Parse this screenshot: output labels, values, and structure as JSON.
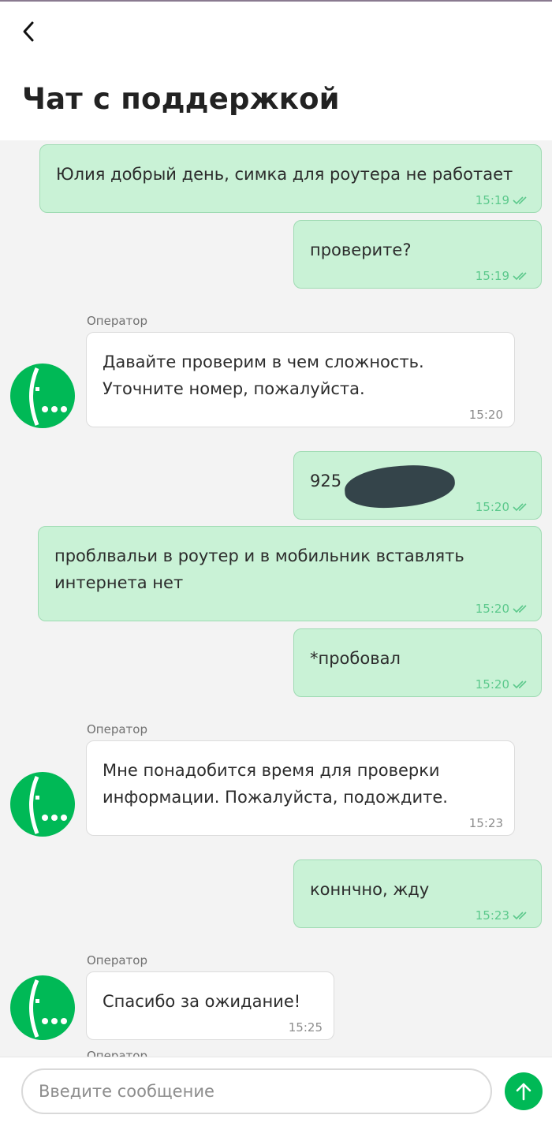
{
  "header": {
    "title": "Чат с поддержкой"
  },
  "messages": [
    {
      "sender": "user",
      "text": "Юлия добрый день, симка для роутера не работает",
      "time": "15:19"
    },
    {
      "sender": "user",
      "text": "проверите?",
      "time": "15:19"
    },
    {
      "sender": "operator",
      "label": "Оператор",
      "text": "Давайте проверим в чем сложность. Уточните номер, пожалуйста.",
      "time": "15:20"
    },
    {
      "sender": "user",
      "text": "925",
      "time": "15:20"
    },
    {
      "sender": "user",
      "text": "проблвальи в роутер и в мобильник вставлять интернета нет",
      "time": "15:20"
    },
    {
      "sender": "user",
      "text": "*пробовал",
      "time": "15:20"
    },
    {
      "sender": "operator",
      "label": "Оператор",
      "text": "Мне понадобится время для проверки информации. Пожалуйста, подождите.",
      "time": "15:23"
    },
    {
      "sender": "user",
      "text": "коннчно, жду",
      "time": "15:23"
    },
    {
      "sender": "operator",
      "label": "Оператор",
      "text": "Спасибо за ожидание!",
      "time": "15:25"
    },
    {
      "sender": "operator",
      "label": "Оператор"
    }
  ],
  "composer": {
    "placeholder": "Введите сообщение"
  },
  "colors": {
    "accent": "#00b956",
    "user_bubble": "#c9f2d6",
    "read_check": "#5cc98c"
  },
  "icons": {
    "back": "chevron-left-icon",
    "send": "arrow-up-icon",
    "read": "double-check-icon",
    "avatar": "operator-logo-icon"
  }
}
